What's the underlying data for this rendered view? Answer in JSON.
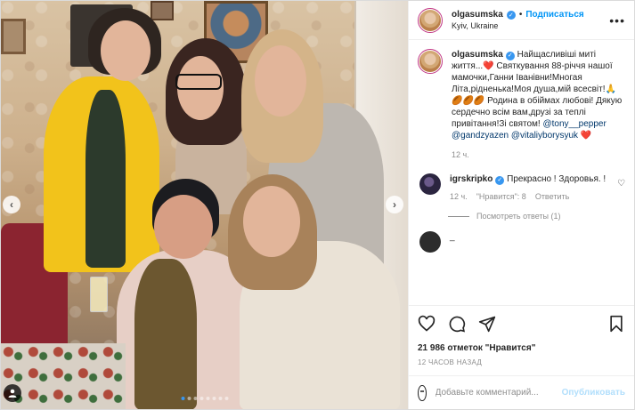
{
  "header": {
    "username": "olgasumska",
    "follow_label": "Подписаться",
    "separator": "•",
    "location": "Kyiv, Ukraine"
  },
  "caption": {
    "username": "olgasumska",
    "text": " Найщасливіші миті життя...❤️ Святкування 88-річчя нашої мамочки,Ганни Іванівни!Многая Літа,рідненька!Моя душа,мій всесвіт!🙏🏉🏉🏉 Родина в обіймах любові! Дякую сердечно всім вам,друзі за теплі привітання!Зі святом! ",
    "mentions": [
      "@tony__pepper",
      "@gandzyazen",
      "@vitaliyborysyuk"
    ],
    "tail": " ❤️",
    "time": "12 ч."
  },
  "comment": {
    "username": "igrskripko",
    "text": " Прекрасно ! Здоровья. !",
    "time": "12 ч.",
    "likes": "\"Нравится\": 8",
    "reply_label": "Ответить",
    "view_replies": "Посмотреть ответы (1)"
  },
  "partial_comment": {
    "text": "_"
  },
  "actions": {
    "likes": "21 986 отметок \"Нравится\"",
    "time_ago": "12 ЧАСОВ НАЗАД"
  },
  "add_comment": {
    "placeholder": "Добавьте комментарий...",
    "post_label": "Опубликовать"
  },
  "photo": {
    "nav_prev": "‹",
    "nav_next": "›",
    "carousel_total": 8,
    "carousel_active_index": 0
  },
  "icons": {
    "header_more": "more-icon",
    "like": "heart-icon",
    "comment": "comment-icon",
    "share": "share-icon",
    "save": "bookmark-icon",
    "tag": "user-tag-icon",
    "emoji": "emoji-icon"
  },
  "colors": {
    "accent": "#0095f6",
    "verified": "#3897f0",
    "post_disabled": "#b2dffc"
  }
}
